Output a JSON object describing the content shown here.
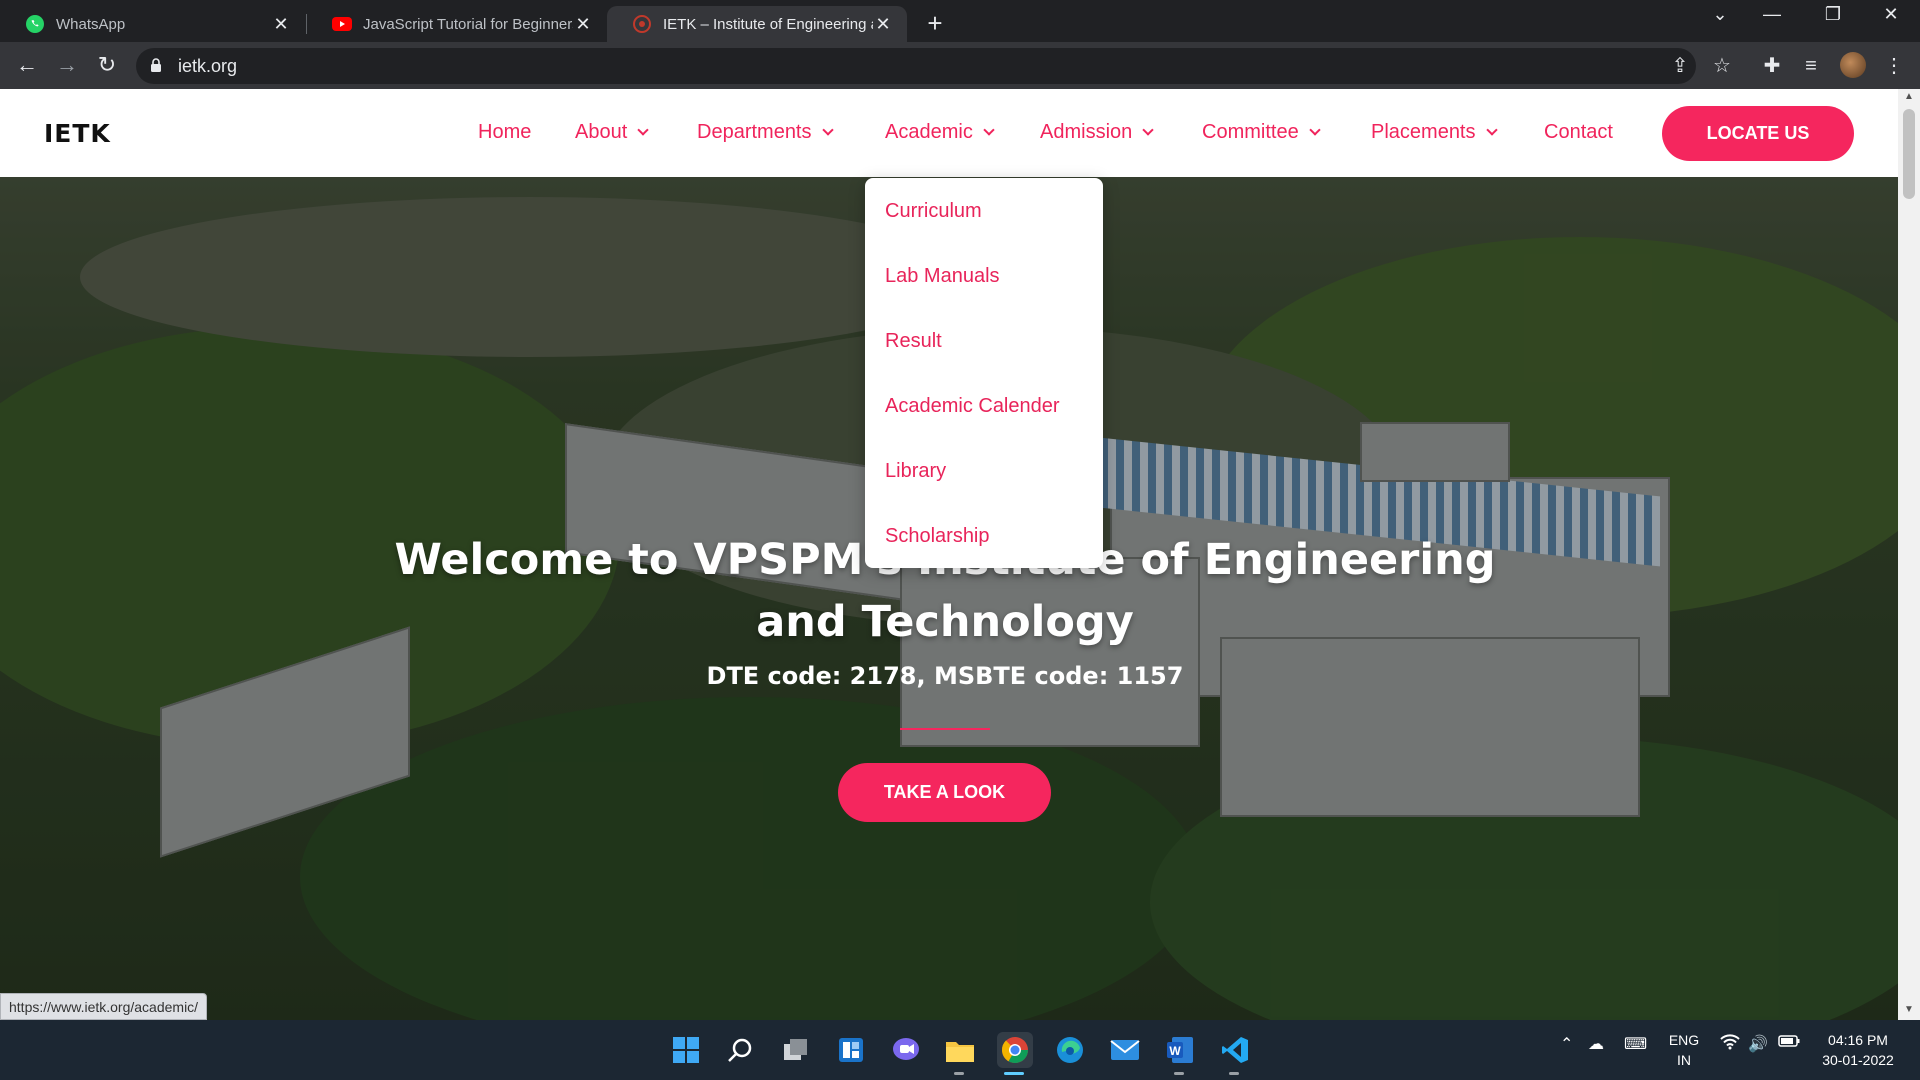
{
  "browser": {
    "tabs": [
      {
        "title": "WhatsApp",
        "icon": "whatsapp-icon"
      },
      {
        "title": "JavaScript Tutorial for Beginners:",
        "icon": "youtube-icon"
      },
      {
        "title": "IETK – Institute of Engineering an",
        "icon": "ietk-favicon",
        "active": true
      }
    ],
    "address": "ietk.org",
    "status_url": "https://www.ietk.org/academic/"
  },
  "site": {
    "logo": "IETK",
    "nav": [
      {
        "label": "Home",
        "dropdown": false
      },
      {
        "label": "About",
        "dropdown": true
      },
      {
        "label": "Departments",
        "dropdown": true
      },
      {
        "label": "Academic",
        "dropdown": true
      },
      {
        "label": "Admission",
        "dropdown": true
      },
      {
        "label": "Committee",
        "dropdown": true
      },
      {
        "label": "Placements",
        "dropdown": true
      },
      {
        "label": "Contact",
        "dropdown": false
      }
    ],
    "cta": "LOCATE US",
    "academic_menu": [
      "Curriculum",
      "Lab Manuals",
      "Result",
      "Academic Calender",
      "Library",
      "Scholarship"
    ],
    "hero": {
      "title_line1": "Welcome to VPSPM's Institute of Engineering",
      "title_line2": "and Technology",
      "subtitle": "DTE code: 2178, MSBTE code: 1157",
      "button": "TAKE A LOOK"
    },
    "accent_color": "#f5265e"
  },
  "taskbar": {
    "lang_line1": "ENG",
    "lang_line2": "IN",
    "time": "04:16 PM",
    "date": "30-01-2022",
    "apps": [
      "start-icon",
      "search-icon",
      "task-view-icon",
      "widgets-icon",
      "teams-chat-icon",
      "file-explorer-icon",
      "chrome-icon",
      "edge-icon",
      "mail-icon",
      "word-icon",
      "vscode-icon"
    ]
  }
}
